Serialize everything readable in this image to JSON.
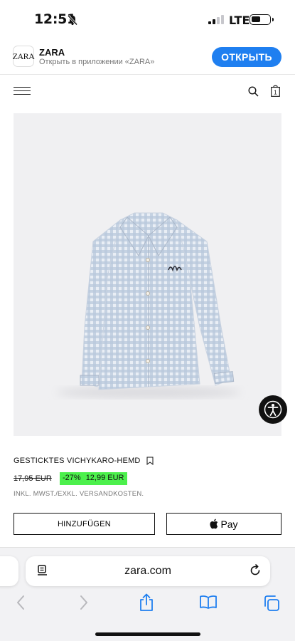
{
  "status_bar": {
    "time": "12:51",
    "network": "LTE"
  },
  "app_banner": {
    "logo_text": "ZARA",
    "app_name": "ZARA",
    "subtitle": "Открыть в приложении «ZARA»",
    "open_label": "ОТКРЫТЬ",
    "open_color": "#1f7ff0"
  },
  "header": {
    "icons": [
      "menu-icon",
      "search-icon",
      "shopping-bag-icon"
    ],
    "bag_count": "1"
  },
  "product": {
    "title": "GESTICKTES VICHYKARO-HEMD",
    "old_price": "17,95 EUR",
    "discount": "-27%",
    "new_price": "12,99 EUR",
    "discount_color": "#4cf04c",
    "tax_note": "INKL. MWST./EXKL. VERSANDKOSTEN.",
    "add_label": "HINZUFÜGEN",
    "pay_label": "Pay"
  },
  "browser": {
    "url": "zara.com"
  }
}
